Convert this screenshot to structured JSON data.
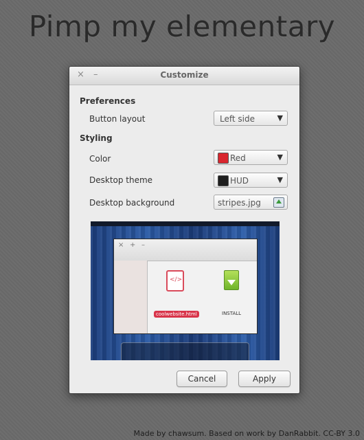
{
  "headline": "Pimp my elementary",
  "dialog": {
    "title": "Customize",
    "close_glyph": "×",
    "minimize_glyph": "–",
    "preferences": {
      "heading": "Preferences",
      "button_layout_label": "Button layout",
      "button_layout_value": "Left side"
    },
    "styling": {
      "heading": "Styling",
      "color_label": "Color",
      "color_value": "Red",
      "desktop_theme_label": "Desktop theme",
      "desktop_theme_value": "HUD",
      "desktop_background_label": "Desktop background",
      "desktop_background_value": "stripes.jpg"
    },
    "preview": {
      "window_controls": [
        "×",
        "+",
        "–"
      ],
      "file1_label": "coolwebsite.html",
      "file1_glyph": "</>",
      "file2_label": "INSTALL"
    },
    "buttons": {
      "cancel": "Cancel",
      "apply": "Apply"
    },
    "dropdown_arrow": "▼"
  },
  "credit": "Made by chawsum. Based on work by DanRabbit. CC-BY 3.0",
  "colors": {
    "red_swatch": "#d9262e",
    "hud_swatch": "#1e1e1e",
    "file_label_bg": "#d8344a",
    "wallpaper_blue": "#2b5ba6"
  },
  "icons": {
    "close": "close-icon",
    "minimize": "minimize-icon",
    "dropdown": "chevron-down-icon",
    "file_chooser": "image-file-icon",
    "html_file": "html-file-icon",
    "install_file": "install-package-icon"
  }
}
